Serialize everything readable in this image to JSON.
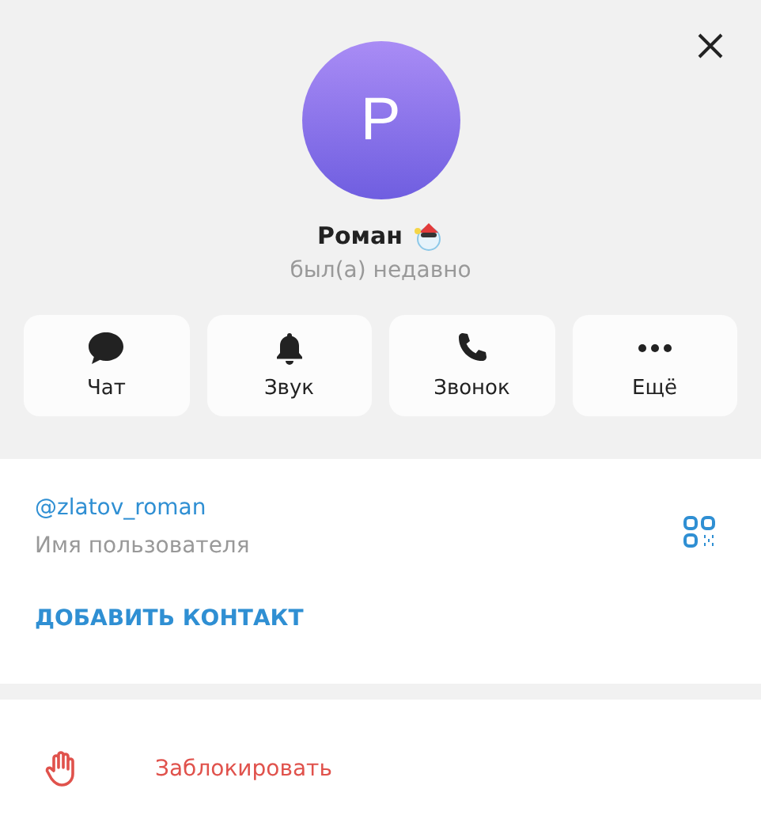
{
  "profile": {
    "avatar_letter": "Р",
    "name": "Роман",
    "status": "был(а) недавно"
  },
  "actions": [
    {
      "kind": "chat",
      "label": "Чат"
    },
    {
      "kind": "sound",
      "label": "Звук"
    },
    {
      "kind": "call",
      "label": "Звонок"
    },
    {
      "kind": "more",
      "label": "Ещё"
    }
  ],
  "info": {
    "username": "@zlatov_roman",
    "username_label": "Имя пользователя",
    "add_contact": "ДОБАВИТЬ КОНТАКТ"
  },
  "block": {
    "label": "Заблокировать"
  }
}
